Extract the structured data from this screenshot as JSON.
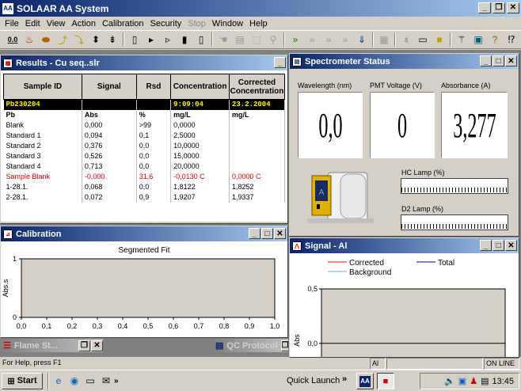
{
  "app": {
    "title": "SOLAAR AA System",
    "icon_text": "AA"
  },
  "menu": [
    "File",
    "Edit",
    "View",
    "Action",
    "Calibration",
    "Security",
    "Stop",
    "Window",
    "Help"
  ],
  "menu_disabled": [
    "Stop"
  ],
  "results": {
    "title": "Results - Cu seq..slr",
    "columns": [
      "Sample ID",
      "Signal",
      "Rsd",
      "Concentration",
      "Corrected Concentration"
    ],
    "header_row": [
      "Pb230204",
      "",
      "",
      "9:09:04",
      "23.2.2004"
    ],
    "unit_row": [
      "Pb",
      "Abs",
      "%",
      "mg/L",
      "mg/L"
    ],
    "rows": [
      [
        "Blank",
        "0,000",
        ">99",
        "0,0000",
        ""
      ],
      [
        "Standard 1",
        "0,094",
        "0,1",
        "2,5000",
        ""
      ],
      [
        "Standard 2",
        "0,376",
        "0,0",
        "10,0000",
        ""
      ],
      [
        "Standard 3",
        "0,526",
        "0,0",
        "15,0000",
        ""
      ],
      [
        "Standard 4",
        "0,713",
        "0,0",
        "20,0000",
        ""
      ],
      [
        "Sample Blank",
        "-0,000",
        "31,6",
        "-0,0130 C",
        "0,0000 C"
      ],
      [
        "1-28.1.",
        "0,068",
        "0,0",
        "1,8122",
        "1,8252"
      ],
      [
        "2-28.1.",
        "0,072",
        "0,9",
        "1,9207",
        "1,9337"
      ]
    ],
    "red_row_index": 5
  },
  "spectrometer": {
    "title": "Spectrometer Status",
    "wavelength_label": "Wavelength (nm)",
    "wavelength_value": "0,0",
    "pmt_label": "PMT Voltage (V)",
    "pmt_value": "0",
    "absorbance_label": "Absorbance (A)",
    "absorbance_value": "3,277",
    "hc_lamp_label": "HC Lamp (%)",
    "d2_lamp_label": "D2 Lamp (%)"
  },
  "calibration": {
    "title": "Calibration",
    "chart_data": {
      "type": "line",
      "title": "Segmented Fit",
      "ylabel": "Abs.s",
      "xlabel": "",
      "xlim": [
        0,
        1
      ],
      "ylim": [
        0,
        1
      ],
      "x_ticks": [
        "0,0",
        "0,1",
        "0,2",
        "0,3",
        "0,4",
        "0,5",
        "0,6",
        "0,7",
        "0,8",
        "0,9",
        "1,0"
      ],
      "y_ticks": [
        "0",
        "1"
      ],
      "series": []
    }
  },
  "signal": {
    "title": "Signal - Al",
    "chart_data": {
      "type": "line",
      "ylabel": "Abs",
      "ylim": [
        -0.5,
        0.5
      ],
      "y_ticks": [
        "0,5",
        "0,0"
      ],
      "legend": [
        "Corrected",
        "Total",
        "Background"
      ],
      "legend_colors": [
        "#ff0000",
        "#0000a0",
        "#6fa8dc"
      ],
      "series": []
    }
  },
  "minimized": [
    {
      "title": "Flame St..."
    },
    {
      "title": "QC Protocol"
    }
  ],
  "statusbar": {
    "help": "For Help, press F1",
    "element": "Al",
    "state": "ON LINE"
  },
  "taskbar": {
    "start": "Start",
    "quick_launch": "Quick Launch",
    "clock": "13:45"
  }
}
